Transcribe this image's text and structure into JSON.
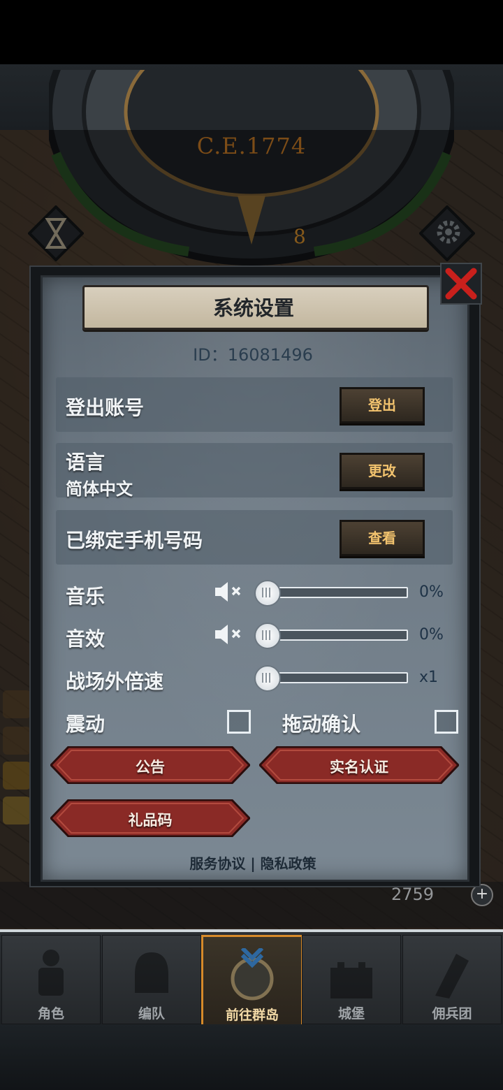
{
  "hud": {
    "calendar_label": "C.E.1774",
    "dial_day": "8",
    "resource_value": "2759"
  },
  "dialog": {
    "title": "系统设置",
    "id_text": "ID：16081496",
    "logout_row": {
      "label": "登出账号",
      "button": "登出"
    },
    "language_row": {
      "label": "语言",
      "value": "简体中文",
      "button": "更改"
    },
    "phone_row": {
      "label": "已绑定手机号码",
      "button": "查看"
    },
    "music": {
      "label": "音乐",
      "value_text": "0%",
      "level": 0
    },
    "sfx": {
      "label": "音效",
      "value_text": "0%",
      "level": 0
    },
    "speed": {
      "label": "战场外倍速",
      "value_text": "x1",
      "level": 0
    },
    "vibration": {
      "label": "震动",
      "checked": false
    },
    "drag_confirm": {
      "label": "拖动确认",
      "checked": false
    },
    "buttons": {
      "announcement": "公告",
      "real_name": "实名认证",
      "gift_code": "礼品码"
    },
    "footer": {
      "service": "服务协议",
      "separator": "|",
      "privacy": "隐私政策"
    }
  },
  "nav": {
    "tabs": [
      {
        "label": "角色",
        "icon": "knight-icon",
        "active": false
      },
      {
        "label": "编队",
        "icon": "helmet-icon",
        "active": false
      },
      {
        "label": "前往群岛",
        "icon": "compass-icon",
        "active": true
      },
      {
        "label": "城堡",
        "icon": "castle-icon",
        "active": false
      },
      {
        "label": "佣兵团",
        "icon": "mercenary-icon",
        "active": false
      }
    ]
  },
  "colors": {
    "accent_orange": "#e28a2a",
    "button_text": "#f2c36e",
    "red_button": "#8a2a26",
    "close_red": "#c8201c",
    "active_tab_border": "#d68a2a"
  }
}
